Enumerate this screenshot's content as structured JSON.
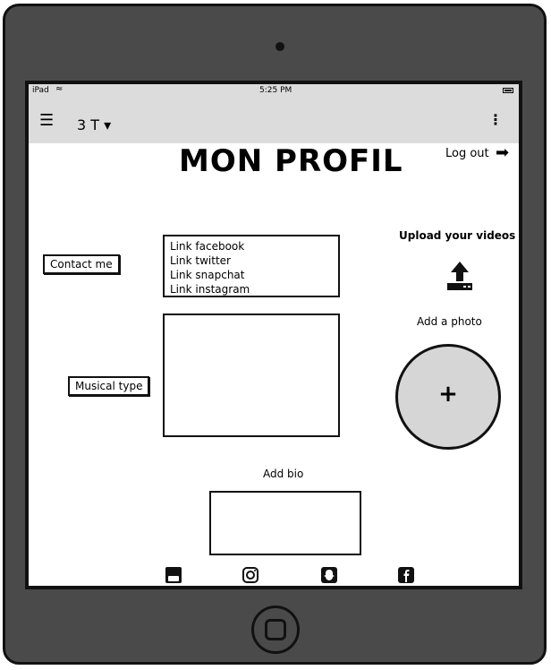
{
  "status_bar": {
    "device": "iPad",
    "time": "5:25 PM"
  },
  "toolbar": {
    "title": "3 T",
    "dropdown_caret": "▾"
  },
  "page": {
    "title": "MON PROFIL",
    "logout_label": "Log out"
  },
  "left_panel": {
    "contact_button": "Contact me",
    "musical_button": "Musical type"
  },
  "links": [
    "Link facebook",
    "Link twitter",
    "Link snapchat",
    "Link instagram"
  ],
  "right_panel": {
    "upload_label": "Upload your videos",
    "add_photo_label": "Add a photo",
    "add_photo_symbol": "+"
  },
  "bio": {
    "label": "Add bio"
  },
  "social_icons": [
    "youtube-icon",
    "instagram-icon",
    "snapchat-icon",
    "facebook-icon"
  ]
}
